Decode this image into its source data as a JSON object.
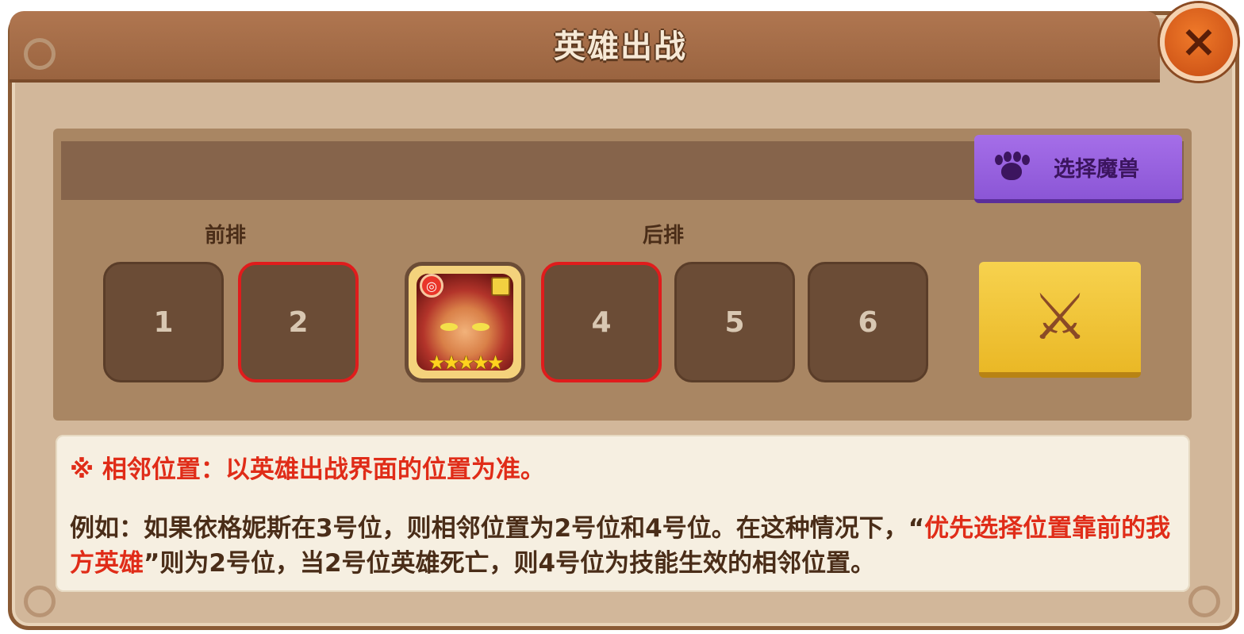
{
  "dialog": {
    "title": "英雄出战",
    "close_icon": "×"
  },
  "beast_button": {
    "label": "选择魔兽",
    "icon": "paw-icon"
  },
  "rows": {
    "front_label": "前排",
    "back_label": "后排"
  },
  "slots": [
    {
      "label": "1",
      "highlighted": false
    },
    {
      "label": "2",
      "highlighted": true
    },
    {
      "label": "",
      "hero": true,
      "stars": 5
    },
    {
      "label": "4",
      "highlighted": true
    },
    {
      "label": "5",
      "highlighted": false
    },
    {
      "label": "6",
      "highlighted": false
    }
  ],
  "hero": {
    "badge": "◎",
    "stars": "★★★★★"
  },
  "battle_button": {
    "icon": "crossed-swords-icon",
    "glyph": "⚔"
  },
  "note": {
    "line1": "※  相邻位置：以英雄出战界面的位置为准。",
    "line2_part1": "例如：如果依格妮斯在3号位，则相邻位置为2号位和4号位。在这种情况下，“",
    "line2_highlight": "优先选择位置靠前的我方英雄",
    "line2_part2": "”则为2号位，当2号位英雄死亡，则4号位为技能生效的相邻位置。"
  },
  "colors": {
    "accent_red": "#e02c18",
    "slot_bg": "#6b4c36",
    "purple_button": "#9a63df",
    "battle_yellow": "#f2c83a"
  }
}
